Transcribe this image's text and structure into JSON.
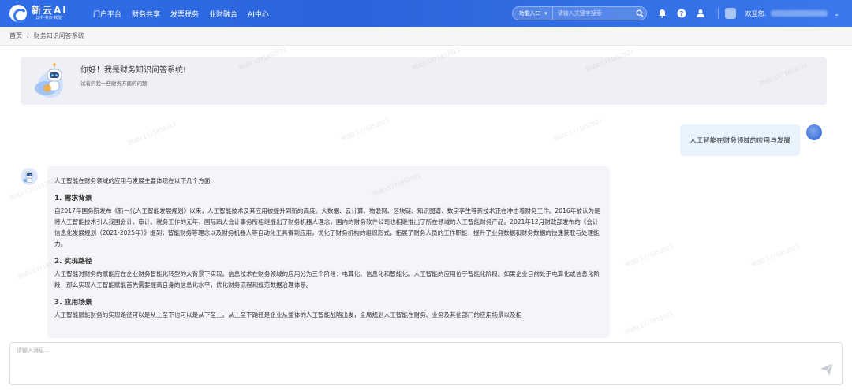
{
  "app": {
    "logo_name": "新云AI",
    "logo_sub": "一云中·共识·赋能一"
  },
  "nav": {
    "items": [
      "门户平台",
      "财务共享",
      "发票税务",
      "业财融合",
      "AI中心"
    ]
  },
  "search": {
    "select_label": "功能入口",
    "placeholder": "请输入关键字搜索"
  },
  "user": {
    "welcome": "欢迎您:"
  },
  "breadcrumb": {
    "home": "首页",
    "separator": "/",
    "current": "财务知识问答系统"
  },
  "welcome_card": {
    "title": "你好！我是财务知识问答系统!",
    "subtitle": "试着问我一些财务方面的问题"
  },
  "chat": {
    "user_message": "人工智能在财务领域的应用与发展",
    "bot": {
      "intro": "人工智能在财务领域的应用与发展主要体现在以下几个方面:",
      "sections": [
        {
          "heading": "1. 需求背景",
          "body": "自2017年国务院发布《新一代人工智能发展规划》以来，人工智能技术及其应用被提升到新的高度。大数据、云计算、物联网、区块链、知识图谱、数字孪生等新技术正在冲击着财务工作。2016年被认为是将人工智能技术引入我国会计、审计、税务工作的元年，国际四大会计事务所相继提出了财务机器人理念，国内的财务软件公司也相继推出了所在领域的人工智能财务产品。2021年12月财政部发布的《会计信息化发展规划（2021-2025年）》提到，智能财务等理念以及财务机器人等自动化工具得到应用，优化了财务机构的组织形式，拓展了财务人员的工作职能，提升了业务数据和财务数据的快速获取与处理能力。"
        },
        {
          "heading": "2. 实现路径",
          "body": "人工智能对财务的赋能应在企业财务智能化转型的大背景下实现。信息技术在财务领域的应用分为三个阶段：电算化、信息化和智能化。人工智能的应用位于智能化阶段。如果企业目前处于电算化或信息化阶段，那么实现人工智能赋能首先需要提高自身的信息化水平，优化财务流程和规范数据治理体系。"
        },
        {
          "heading": "3. 应用场景",
          "body": "人工智能赋能财务的实现路径可以是从上至下也可以是从下至上。从上至下路径是企业从整体的人工智能战略出发，全局规划人工智能在财务、业务及其他部门的应用场景以及相"
        }
      ]
    }
  },
  "composer": {
    "placeholder": "请输入消息..."
  },
  "watermark_text": "测试0:1371852021",
  "icons": {
    "search": "search-icon",
    "bell": "bell-icon",
    "help": "help-icon",
    "user_group": "user-group-icon",
    "send": "send-icon",
    "chevron": "chevron-down-icon"
  },
  "colors": {
    "header": "#2f6ee8",
    "user_bubble": "#e8f3fe",
    "bot_bubble": "#f4f5f8",
    "welcome_card": "#eef0f5"
  }
}
